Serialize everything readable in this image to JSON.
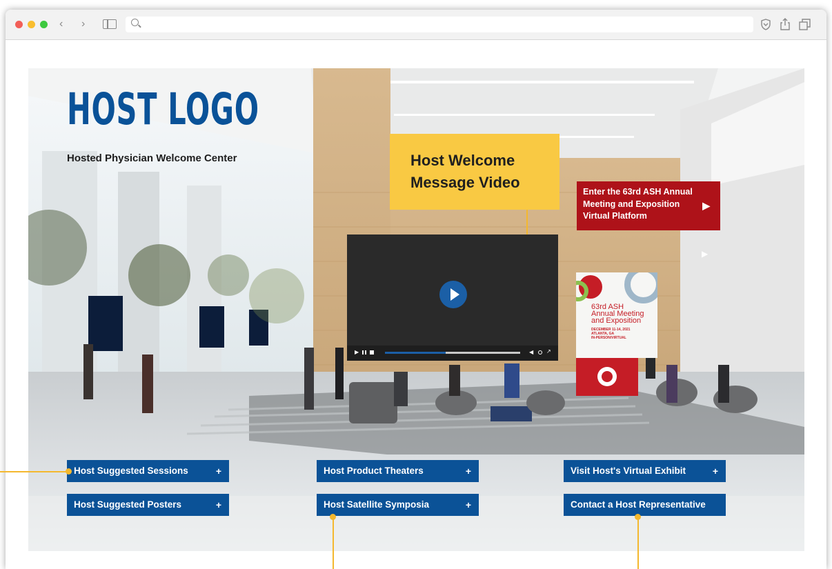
{
  "browser": {
    "traffic_colors": [
      "#f25f58",
      "#f9be2f",
      "#3dc93f"
    ]
  },
  "page": {
    "logo": "HOST LOGO",
    "subtitle": "Hosted Physician Welcome Center",
    "video_callout": "Host Welcome Message Video",
    "enter_link": "Enter the 63rd ASH Annual Meeting and Exposition Virtual Platform",
    "banner": {
      "line1": "63rd ASH",
      "line2": "Annual Meeting",
      "line3": "and Exposition",
      "dates": "DECEMBER 11-14, 2021",
      "place": "ATLANTA, GA",
      "mode": "IN-PERSON/VIRTUAL"
    },
    "video_progress": 0.45,
    "buttons": {
      "sessions": "Host Suggested Sessions",
      "posters": "Host Suggested Posters",
      "theaters": "Host Product Theaters",
      "symposia": "Host Satellite Symposia",
      "exhibit": "Visit Host's Virtual Exhibit",
      "contact": "Contact a Host Representative",
      "plus": "+"
    }
  },
  "colors": {
    "brand_blue": "#0b5297",
    "callout_yellow": "#f9c943",
    "ash_red": "#ae1219"
  }
}
